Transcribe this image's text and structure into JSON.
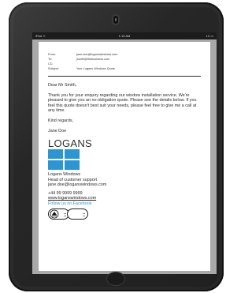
{
  "status_bar": {
    "carrier": "iPad ᯤ",
    "time": "1:15 AM",
    "battery": "12 ▭"
  },
  "email": {
    "header": {
      "from_label": "From:",
      "from_value": "jane.doe@loganswindows.com",
      "to_label": "To:",
      "to_value": "jsmith@thebusiness.com",
      "cc_label": "CC:",
      "cc_value": "",
      "subject_label": "Subject:",
      "subject_value": "Your Logans Windows Quote"
    },
    "greeting": "Dear Mr Smith,",
    "paragraph": "Thank you for your enquiry regarding our window installation service. We're pleased to give you an no-obligation quote. Please see the details below. If you feel this quote doesn't best suit your needs, please feel free to give me a call at any time.",
    "closing": "Kind regards,",
    "sender_name": "Jane Doe"
  },
  "signature": {
    "logo_text": "LOGANS",
    "logo_color": "#2c96d3",
    "company": "Logans Windows",
    "role": "Head of customer support",
    "email": "jane.doe@loganswindows.com",
    "phone": "+44 99 9999 9999",
    "website": "www.loganswindows.com",
    "facebook": "Follow us on Facebook",
    "badge_icons": [
      "certification-seal-icon",
      "accreditation-seal-icon"
    ]
  }
}
